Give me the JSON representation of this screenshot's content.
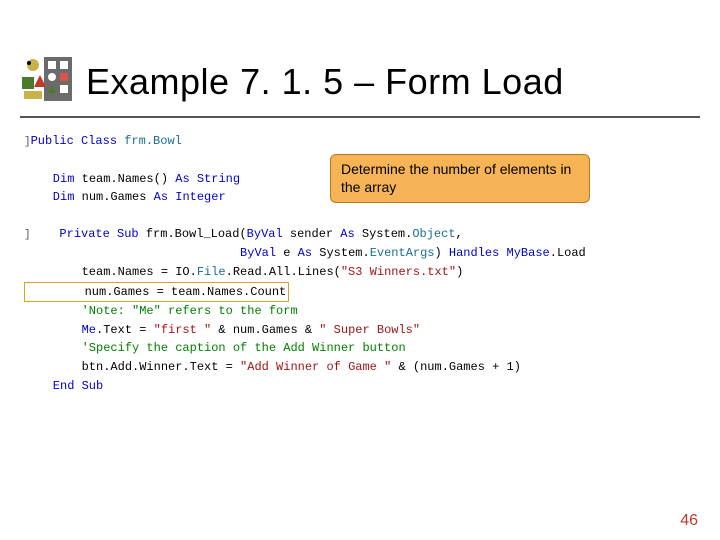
{
  "title": "Example 7. 1. 5 – Form Load",
  "callout": "Determine the number of elements in the array",
  "code": {
    "l01a": "Public Class",
    "l01b": " frm.Bowl",
    "l02a": "    Dim",
    "l02b": " team.Names() ",
    "l02c": "As String",
    "l03a": "    Dim",
    "l03b": " num.Games ",
    "l03c": "As Integer",
    "l04a": "    Private Sub",
    "l04b": " frm.Bowl_Load(",
    "l04c": "ByVal",
    "l04d": " sender ",
    "l04e": "As",
    "l04f": " System.",
    "l04g": "Object",
    "l04h": ",",
    "l05a": "                              ",
    "l05b": "ByVal",
    "l05c": " e ",
    "l05d": "As",
    "l05e": " System.",
    "l05f": "EventArgs",
    "l05g": ") ",
    "l05h": "Handles",
    "l05i": " ",
    "l05j": "MyBase",
    "l05k": ".Load",
    "l06a": "        team.Names = IO.",
    "l06b": "File",
    "l06c": ".Read.All.Lines(",
    "l06d": "\"S3 Winners.txt\"",
    "l06e": ")",
    "l07": "        num.Games = team.Names.Count",
    "l08": "        'Note: \"Me\" refers to the form",
    "l09a": "        ",
    "l09b": "Me",
    "l09c": ".Text = ",
    "l09d": "\"first \"",
    "l09e": " & num.Games & ",
    "l09f": "\" Super Bowls\"",
    "l10": "        'Specify the caption of the Add Winner button",
    "l11a": "        btn.Add.Winner.Text = ",
    "l11b": "\"Add Winner of Game \"",
    "l11c": " & (num.Games + 1)",
    "l12": "    End Sub"
  },
  "page_number": "46"
}
